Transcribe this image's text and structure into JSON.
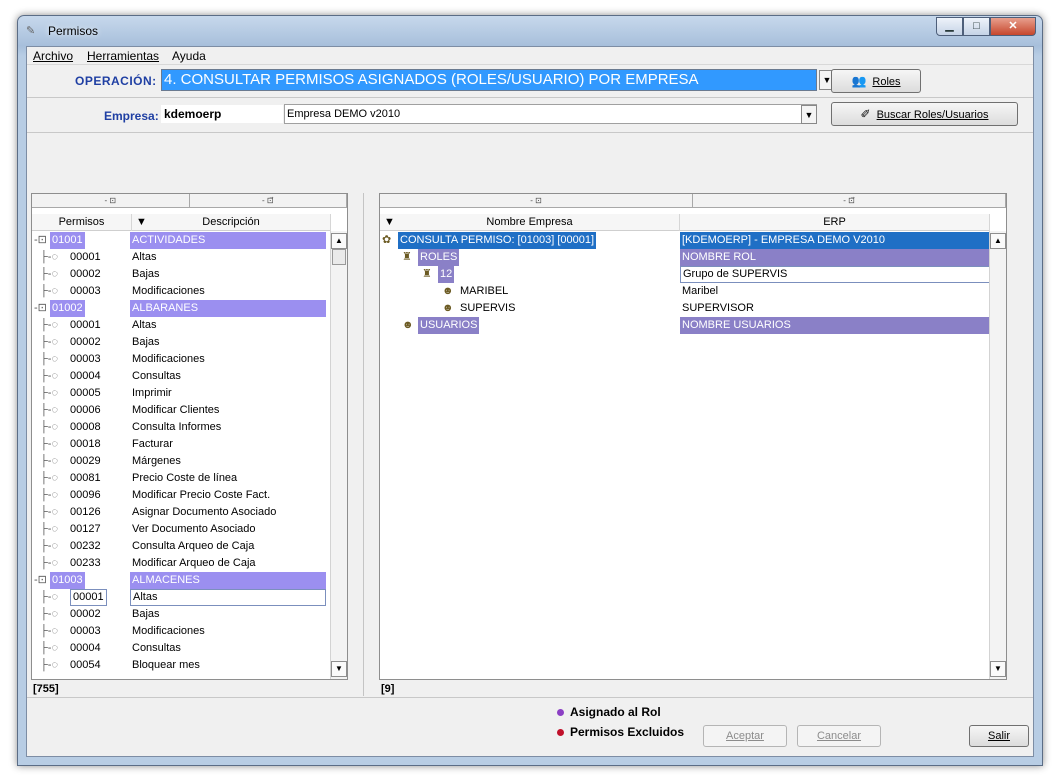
{
  "window": {
    "title": "Permisos"
  },
  "menu": [
    "Archivo",
    "Herramientas",
    "Ayuda"
  ],
  "operation": {
    "label": "OPERACIÓN:",
    "value": "4. CONSULTAR PERMISOS ASIGNADOS (ROLES/USUARIO) POR EMPRESA",
    "roles_button": "Roles"
  },
  "empresa": {
    "label": "Empresa:",
    "code": "kdemoerp",
    "name": "Empresa DEMO v2010",
    "search_button": "Buscar Roles/Usuarios"
  },
  "left_panel": {
    "columns": [
      "Permisos",
      "Descripción"
    ],
    "rows": [
      {
        "code": "01001",
        "desc": "ACTIVIDADES",
        "group": true
      },
      {
        "code": "00001",
        "desc": "Altas"
      },
      {
        "code": "00002",
        "desc": "Bajas"
      },
      {
        "code": "00003",
        "desc": "Modificaciones"
      },
      {
        "code": "01002",
        "desc": "ALBARANES",
        "group": true
      },
      {
        "code": "00001",
        "desc": "Altas"
      },
      {
        "code": "00002",
        "desc": "Bajas"
      },
      {
        "code": "00003",
        "desc": "Modificaciones"
      },
      {
        "code": "00004",
        "desc": "Consultas"
      },
      {
        "code": "00005",
        "desc": "Imprimir"
      },
      {
        "code": "00006",
        "desc": "Modificar Clientes"
      },
      {
        "code": "00008",
        "desc": "Consulta Informes"
      },
      {
        "code": "00018",
        "desc": "Facturar"
      },
      {
        "code": "00029",
        "desc": "Márgenes"
      },
      {
        "code": "00081",
        "desc": "Precio Coste de línea"
      },
      {
        "code": "00096",
        "desc": "Modificar Precio Coste Fact."
      },
      {
        "code": "00126",
        "desc": "Asignar Documento Asociado"
      },
      {
        "code": "00127",
        "desc": "Ver Documento Asociado"
      },
      {
        "code": "00232",
        "desc": "Consulta Arqueo de Caja"
      },
      {
        "code": "00233",
        "desc": "Modificar Arqueo de Caja"
      },
      {
        "code": "01003",
        "desc": "ALMACENES",
        "group": true
      },
      {
        "code": "00001",
        "desc": "Altas",
        "selected": true
      },
      {
        "code": "00002",
        "desc": "Bajas"
      },
      {
        "code": "00003",
        "desc": "Modificaciones"
      },
      {
        "code": "00004",
        "desc": "Consultas"
      },
      {
        "code": "00054",
        "desc": "Bloquear mes"
      }
    ],
    "count": "[755]"
  },
  "right_panel": {
    "columns": [
      "Nombre Empresa",
      "ERP"
    ],
    "rows": [
      {
        "name": "CONSULTA PERMISO: [01003] [00001]",
        "erp": "[KDEMOERP] - EMPRESA DEMO V2010"
      },
      {
        "name": "ROLES",
        "erp": "NOMBRE ROL"
      },
      {
        "name": "12",
        "erp": "Grupo de SUPERVIS"
      },
      {
        "name": "MARIBEL",
        "erp": "Maribel"
      },
      {
        "name": "SUPERVIS",
        "erp": "SUPERVISOR"
      },
      {
        "name": "USUARIOS",
        "erp": "NOMBRE USUARIOS"
      }
    ],
    "count": "[9]"
  },
  "legend": {
    "assigned": "Asignado al Rol",
    "excluded": "Permisos Excluidos",
    "assigned_color": "#8b3fc4",
    "excluded_color": "#c0102a"
  },
  "footer": {
    "accept": "Aceptar",
    "cancel": "Cancelar",
    "exit": "Salir"
  }
}
